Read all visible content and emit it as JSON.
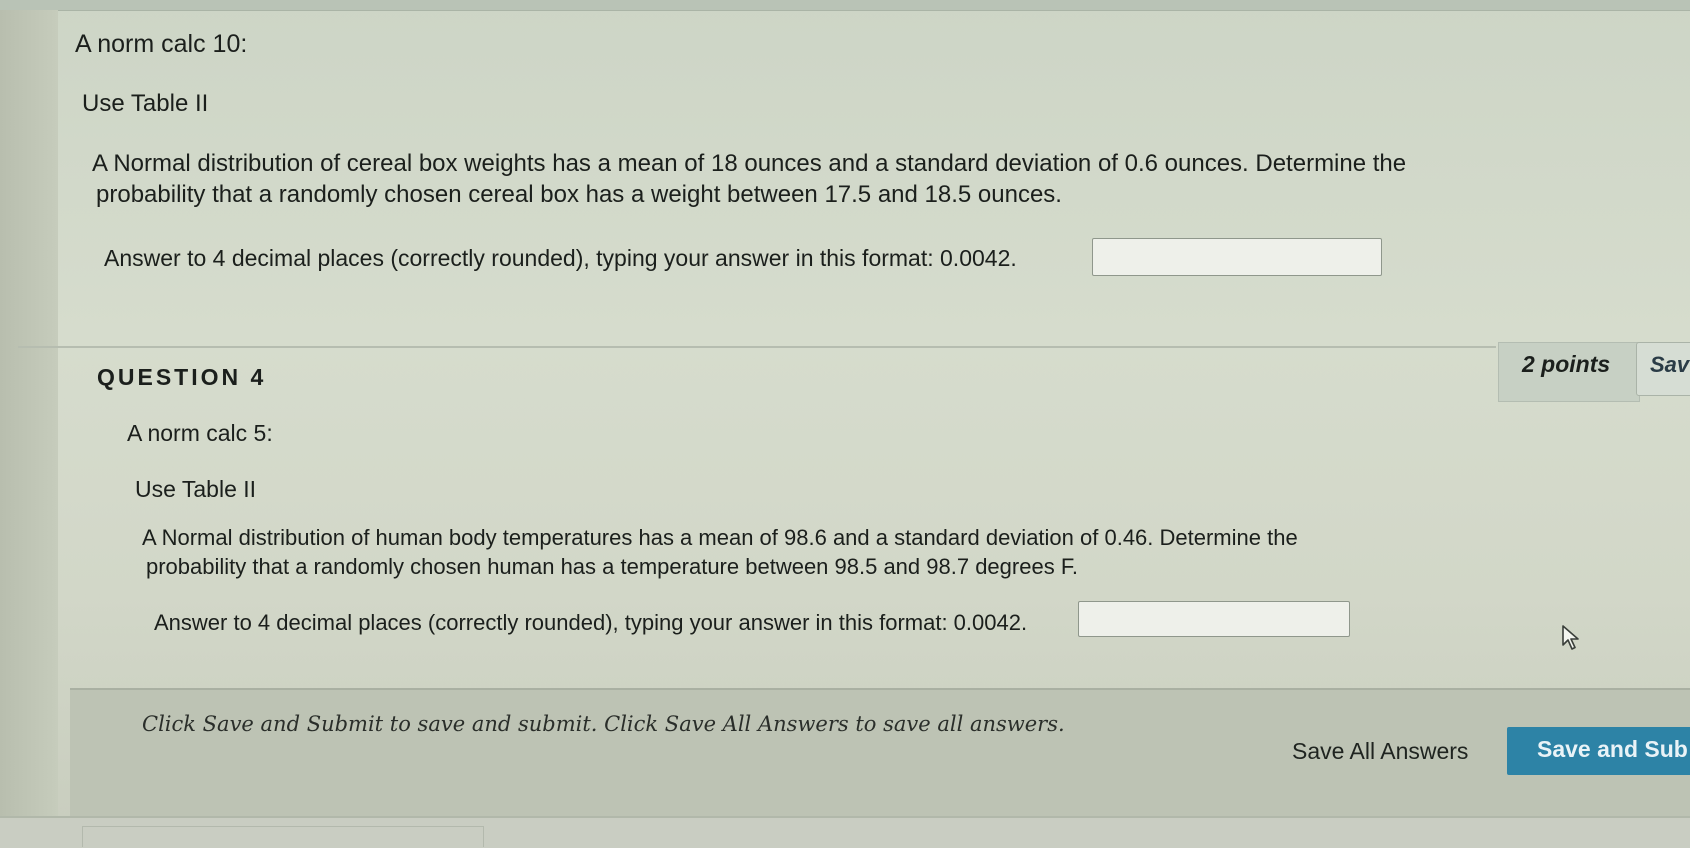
{
  "previous_question": {
    "title": "A norm calc 10:",
    "table_note": "Use Table II",
    "prompt_line1": "A Normal distribution of cereal box weights has a mean of 18 ounces and a standard deviation of 0.6 ounces. Determine the",
    "prompt_line2": "probability that a randomly chosen cereal box has a weight between 17.5 and 18.5 ounces.",
    "answer_instruction": "Answer to 4 decimal places (correctly rounded), typing your answer in this format: 0.0042.",
    "answer_value": ""
  },
  "question4": {
    "heading": "QUESTION 4",
    "points": "2 points",
    "save_label": "Sav",
    "title": "A norm calc 5:",
    "table_note": "Use Table II",
    "prompt_line1": "A Normal distribution of human body temperatures has a mean of 98.6 and a standard deviation of 0.46. Determine the",
    "prompt_line2": "probability that a randomly chosen human has a temperature between 98.5 and 98.7 degrees F.",
    "answer_instruction": "Answer to 4 decimal places (correctly rounded), typing your answer in this format: 0.0042.",
    "answer_value": ""
  },
  "footer": {
    "message": "Click Save and Submit to save and submit. Click Save All Answers to save all answers.",
    "save_all_label": "Save All Answers",
    "save_submit_label": "Save and Sub"
  },
  "icons": {
    "cursor": "mouse-pointer-icon"
  },
  "colors": {
    "primary_button": "#2d83a6",
    "background": "#d3d9cb"
  }
}
